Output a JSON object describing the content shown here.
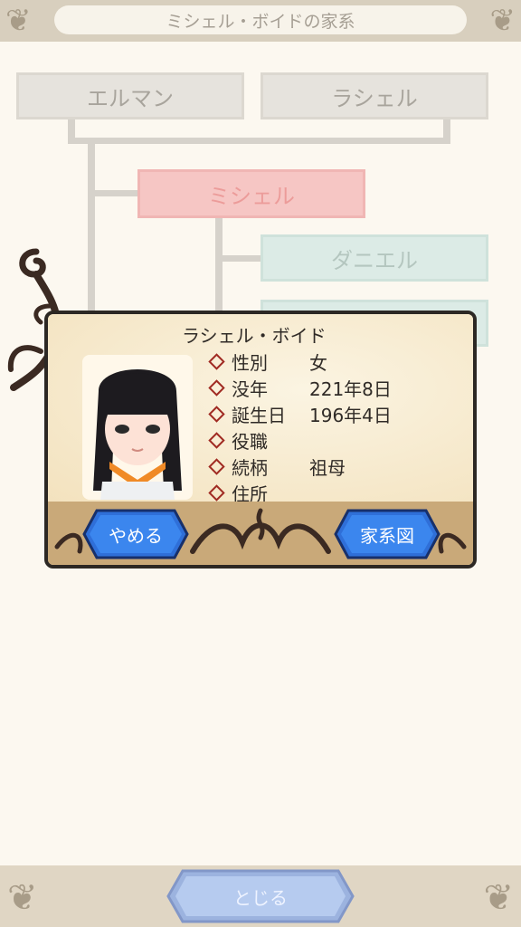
{
  "header": {
    "title": "ミシェル・ボイドの家系"
  },
  "tree": {
    "parents": [
      "エルマン",
      "ラシェル"
    ],
    "self": "ミシェル",
    "children": [
      "ダニエル"
    ]
  },
  "dialog": {
    "name": "ラシェル・ボイド",
    "fields": [
      {
        "label": "性別",
        "value": "女"
      },
      {
        "label": "没年",
        "value": "221年8日"
      },
      {
        "label": "誕生日",
        "value": "196年4日"
      },
      {
        "label": "役職",
        "value": ""
      },
      {
        "label": "続柄",
        "value": "祖母"
      },
      {
        "label": "住所",
        "value": ""
      }
    ],
    "cancel_label": "やめる",
    "family_tree_label": "家系図"
  },
  "footer": {
    "close_label": "とじる"
  },
  "colors": {
    "accent_blue": "#2f6fd8",
    "frame_dark": "#2c2824",
    "self_pink": "#f6c6c4"
  }
}
